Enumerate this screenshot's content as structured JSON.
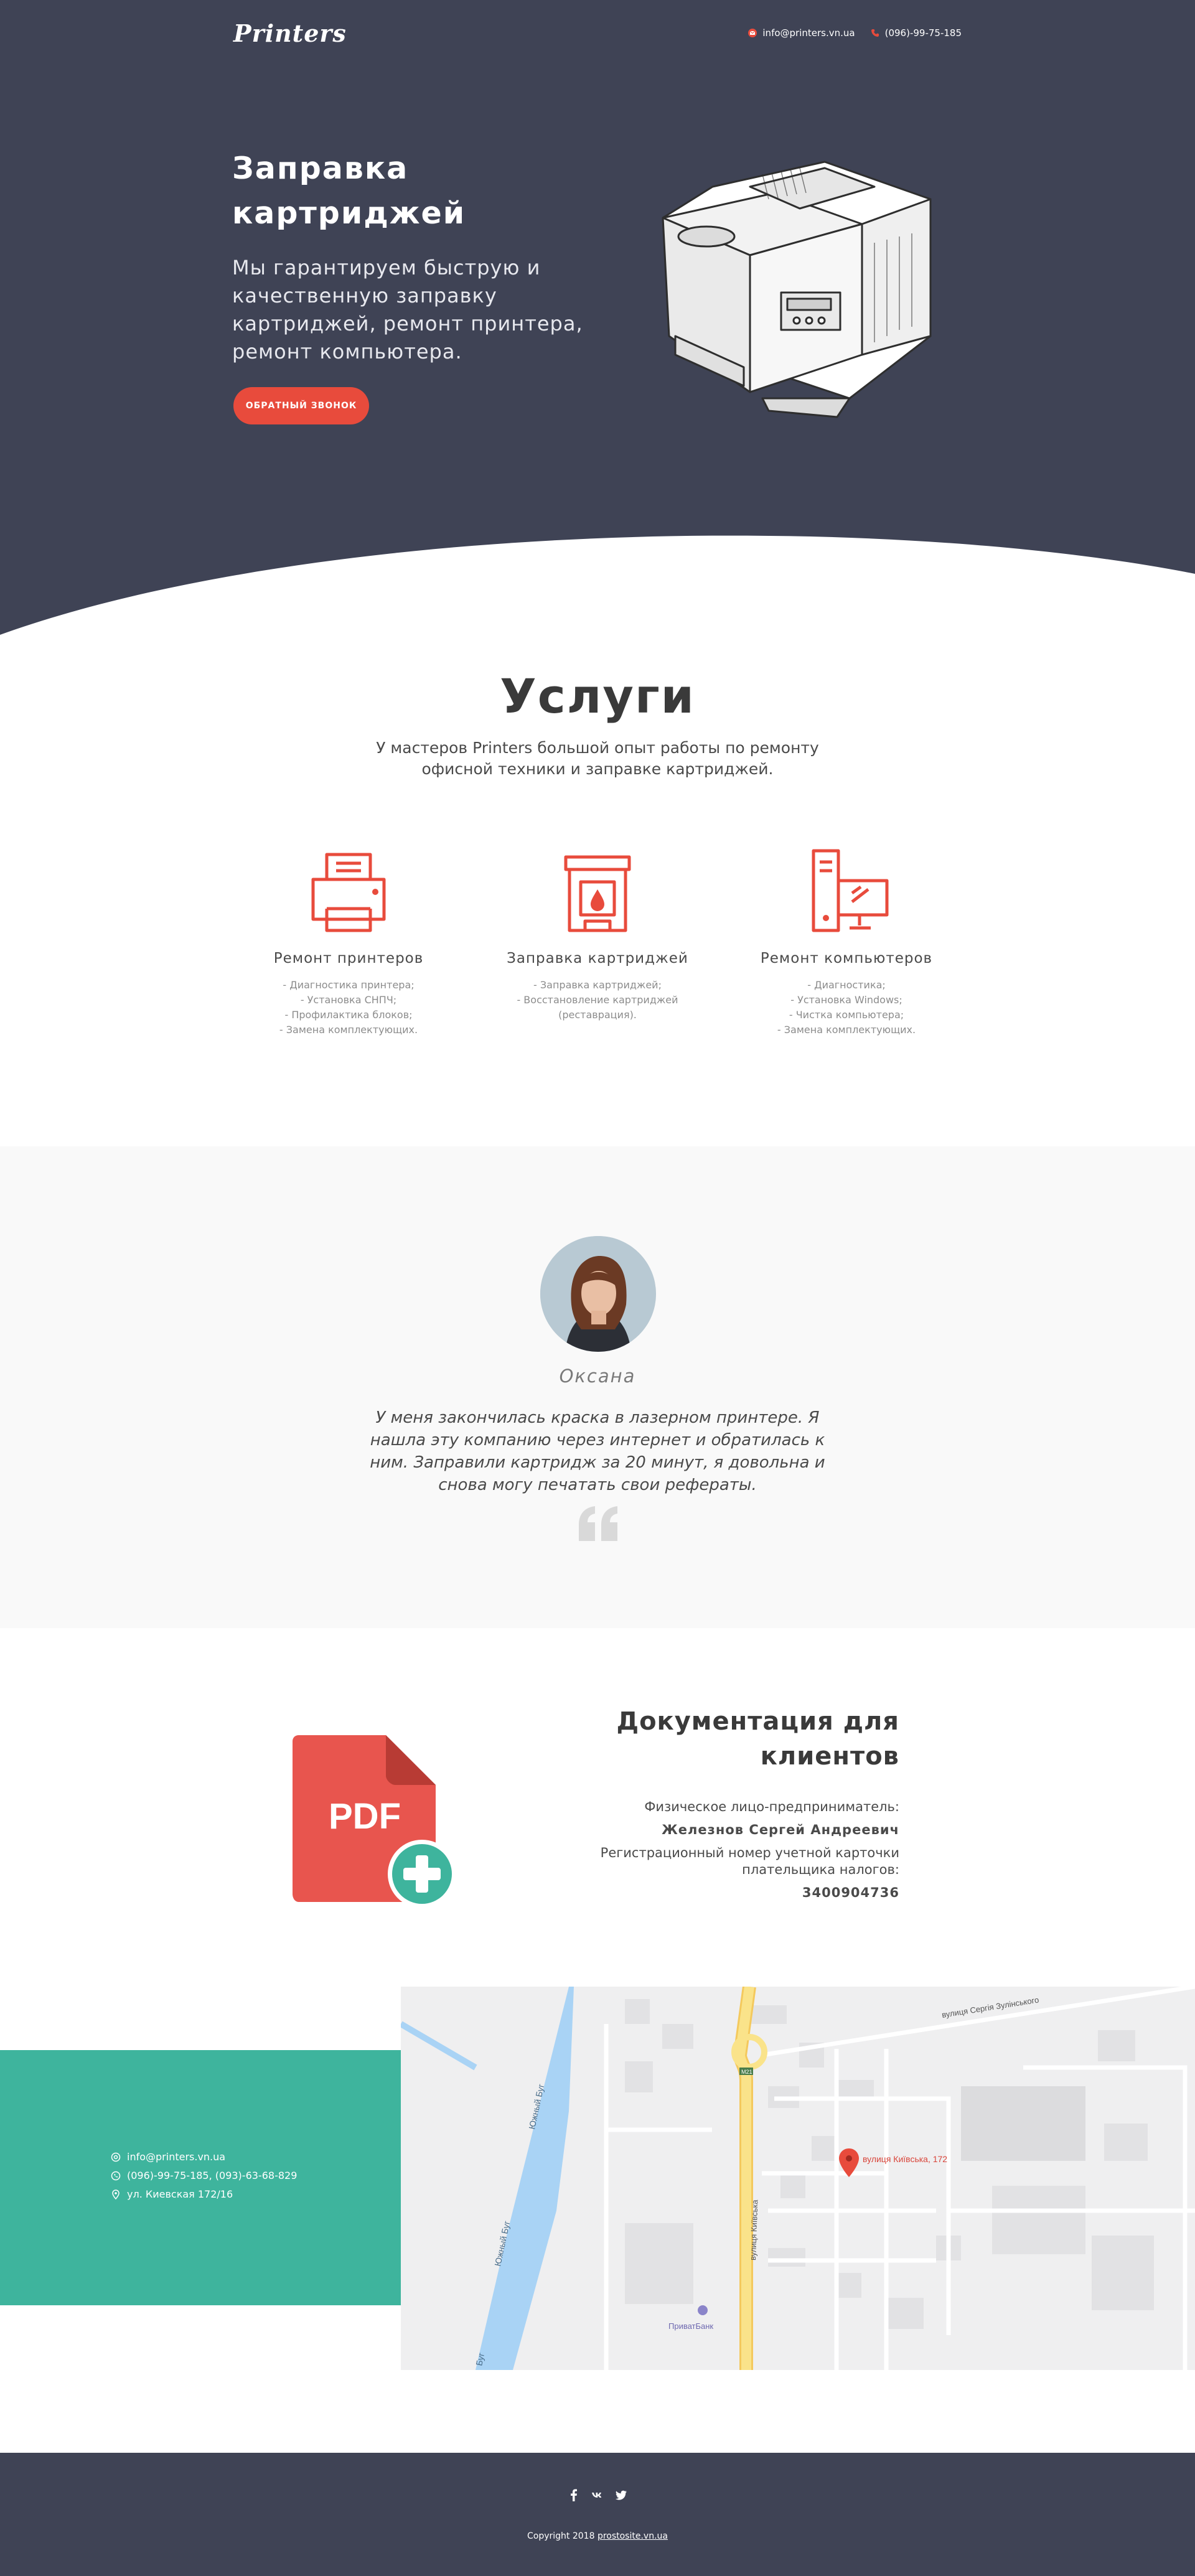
{
  "header": {
    "logo": "Printers",
    "email": "info@printers.vn.ua",
    "phone": "(096)-99-75-185"
  },
  "hero": {
    "title": "Заправка картриджей",
    "subtitle": "Мы гарантируем быструю и качественную заправку картриджей, ремонт принтера, ремонт компьютера.",
    "callback_button": "ОБРАТНЫЙ ЗВОНОК"
  },
  "services": {
    "title": "Услуги",
    "description": "У мастеров Printers большой опыт работы по ремонту офисной техники и заправке картриджей.",
    "items": [
      {
        "name": "Ремонт принтеров",
        "icon": "printer-icon",
        "lines": [
          "- Диагностика принтера;",
          "- Установка СНПЧ;",
          "- Профилактика блоков;",
          "- Замена комплектующих."
        ]
      },
      {
        "name": "Заправка картриджей",
        "icon": "cartridge-icon",
        "lines": [
          "- Заправка картриджей;",
          "- Восстановление картриджей",
          "(реставрация)."
        ]
      },
      {
        "name": "Ремонт компьютеров",
        "icon": "computer-icon",
        "lines": [
          "- Диагностика;",
          "- Установка Windows;",
          "- Чистка компьютера;",
          "- Замена комплектующих."
        ]
      }
    ]
  },
  "testimonial": {
    "name": "Оксана",
    "quote": "У меня закончилась краска в лазерном принтере. Я нашла эту компанию через интернет и обратилась к ним. Заправили картридж за 20 минут, я довольна и снова могу печатать свои рефераты."
  },
  "documents": {
    "title": "Документация для клиентов",
    "entrepreneur_label": "Физическое лицо-предприниматель:",
    "entrepreneur_name": "Железнов Сергей Андреевич",
    "tax_label": "Регистрационный номер учетной карточки плательщика налогов:",
    "tax_number": "3400904736",
    "pdf_text": "PDF"
  },
  "contact": {
    "email": "info@printers.vn.ua",
    "phones": "(096)-99-75-185, (093)-63-68-829",
    "address": "ул. Киевская 172/16"
  },
  "map": {
    "pin_label": "вулиця Київська, 172",
    "road_label": "вулиця Київська",
    "river_label_1": "Южный Буг",
    "river_label_2": "Южный Буг",
    "river_label_3": "Буг",
    "street_label": "вулиця Сергія Зулінського",
    "bank_label": "ПриватБанк",
    "road_number": "М21",
    "colors": {
      "river": "#a9d3f5",
      "road": "#fae38a",
      "pin": "#e84b3c"
    }
  },
  "footer": {
    "copyright_prefix": "Copyright 2018 ",
    "copyright_link": "prostosite.vn.ua"
  },
  "colors": {
    "dark": "#3f4355",
    "accent": "#e84b3c",
    "green": "#3eb49d",
    "light_bg": "#f9f9f9"
  }
}
